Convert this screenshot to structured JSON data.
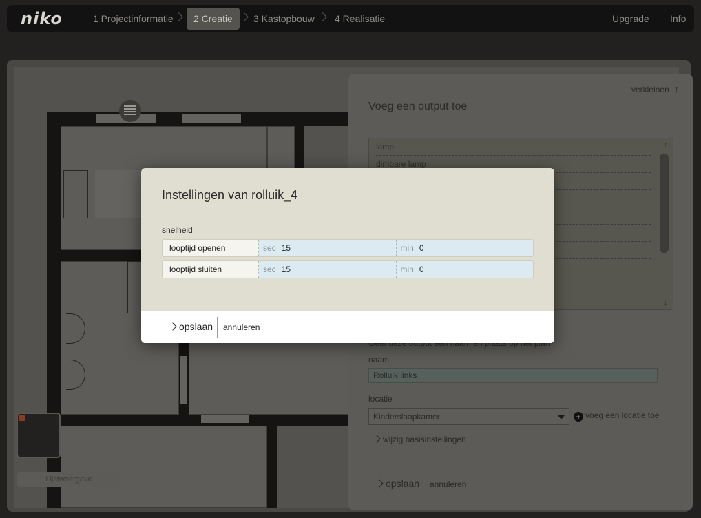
{
  "app": {
    "logo": "niko"
  },
  "nav": {
    "steps": [
      {
        "label": "1 Projectinformatie",
        "active": false
      },
      {
        "label": "2 Creatie",
        "active": true
      },
      {
        "label": "3 Kastopbouw",
        "active": false
      },
      {
        "label": "4 Realisatie",
        "active": false
      }
    ],
    "upgrade": "Upgrade",
    "info": "Info",
    "separator": "|"
  },
  "canvas": {
    "list_view_button": "Lijstweergave",
    "blind_icon": "roller-blind-icon"
  },
  "panel": {
    "collapse_label": "verkleinen",
    "collapse_icon": "arrow-up-icon",
    "title": "Voeg een output toe",
    "output_items": [
      "lamp",
      "dimbare lamp",
      "",
      "",
      "",
      "",
      "",
      "",
      ""
    ],
    "hint": "Geef deze output een naam en plaats op het plan",
    "name_label": "naam",
    "name_value": "Rolluik links",
    "location_label": "locatie",
    "location_value": "Kinderslaapkamer",
    "add_location": "voeg een locatie toe",
    "basic_settings": "wijzig basisinstellingen",
    "save": "opslaan",
    "cancel": "annuleren"
  },
  "modal": {
    "title": "Instellingen van rolluik_4",
    "section": "snelheid",
    "rows": [
      {
        "label": "looptijd openen",
        "sec_unit": "sec",
        "sec_value": "15",
        "min_unit": "min",
        "min_value": "0"
      },
      {
        "label": "looptijd sluiten",
        "sec_unit": "sec",
        "sec_value": "15",
        "min_unit": "min",
        "min_value": "0"
      }
    ],
    "save": "opslaan",
    "cancel": "annuleren"
  },
  "colors": {
    "topbar": "#121212",
    "modal_bg": "#e0ddd1",
    "input_bg": "#dcebf1"
  }
}
